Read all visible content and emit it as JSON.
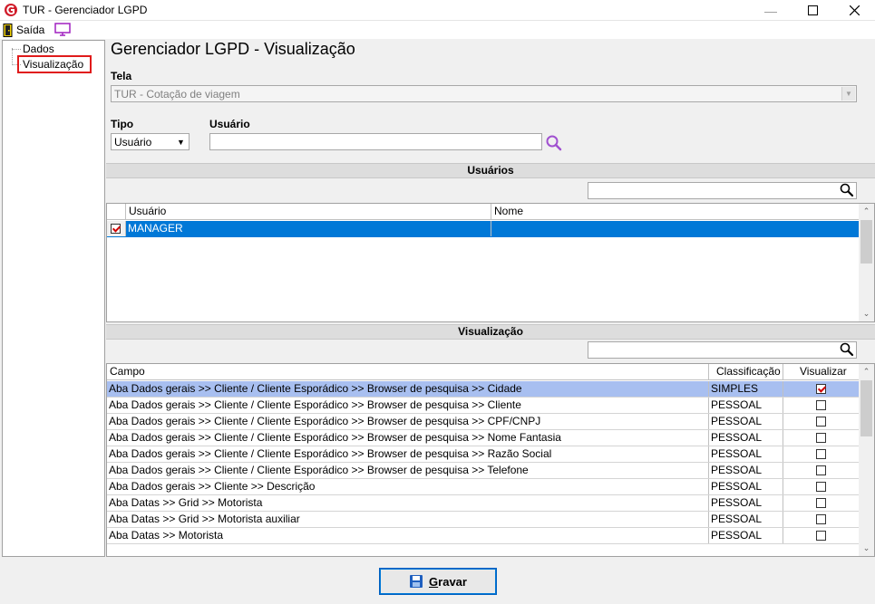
{
  "window": {
    "title": "TUR - Gerenciador LGPD"
  },
  "menu": {
    "exit_label": "Saída"
  },
  "tree": {
    "items": [
      "Dados",
      "Visualização"
    ]
  },
  "page": {
    "title": "Gerenciador LGPD - Visualização"
  },
  "tela": {
    "label": "Tela",
    "value": "TUR - Cotação de viagem"
  },
  "tipo": {
    "label": "Tipo",
    "value": "Usuário"
  },
  "usuario": {
    "label": "Usuário",
    "value": ""
  },
  "users_section": {
    "title": "Usuários",
    "columns": [
      "Usuário",
      "Nome"
    ],
    "rows": [
      {
        "checked": true,
        "usuario": "MANAGER",
        "nome": ""
      }
    ]
  },
  "view_section": {
    "title": "Visualização",
    "columns": [
      "Campo",
      "Classificação",
      "Visualizar"
    ],
    "rows": [
      {
        "campo": "Aba Dados gerais >> Cliente / Cliente Esporádico >> Browser de pesquisa >> Cidade",
        "classificacao": "SIMPLES",
        "visualizar": true
      },
      {
        "campo": "Aba Dados gerais >> Cliente / Cliente Esporádico >> Browser de pesquisa >> Cliente",
        "classificacao": "PESSOAL",
        "visualizar": false
      },
      {
        "campo": "Aba Dados gerais >> Cliente / Cliente Esporádico >> Browser de pesquisa >> CPF/CNPJ",
        "classificacao": "PESSOAL",
        "visualizar": false
      },
      {
        "campo": "Aba Dados gerais >> Cliente / Cliente Esporádico >> Browser de pesquisa >> Nome Fantasia",
        "classificacao": "PESSOAL",
        "visualizar": false
      },
      {
        "campo": "Aba Dados gerais >> Cliente / Cliente Esporádico >> Browser de pesquisa >> Razão Social",
        "classificacao": "PESSOAL",
        "visualizar": false
      },
      {
        "campo": "Aba Dados gerais >> Cliente / Cliente Esporádico >> Browser de pesquisa >> Telefone",
        "classificacao": "PESSOAL",
        "visualizar": false
      },
      {
        "campo": "Aba Dados gerais >> Cliente >> Descrição",
        "classificacao": "PESSOAL",
        "visualizar": false
      },
      {
        "campo": "Aba Datas >> Grid >> Motorista",
        "classificacao": "PESSOAL",
        "visualizar": false
      },
      {
        "campo": "Aba Datas >> Grid >> Motorista auxiliar",
        "classificacao": "PESSOAL",
        "visualizar": false
      },
      {
        "campo": "Aba Datas >> Motorista",
        "classificacao": "PESSOAL",
        "visualizar": false
      }
    ]
  },
  "save_button": {
    "label_first": "G",
    "label_rest": "ravar"
  },
  "colors": {
    "selection": "#a8bff0",
    "highlight_user": "#0078d7",
    "tree_selection_border": "#e01b1b",
    "search_icon": "#a050d0"
  }
}
